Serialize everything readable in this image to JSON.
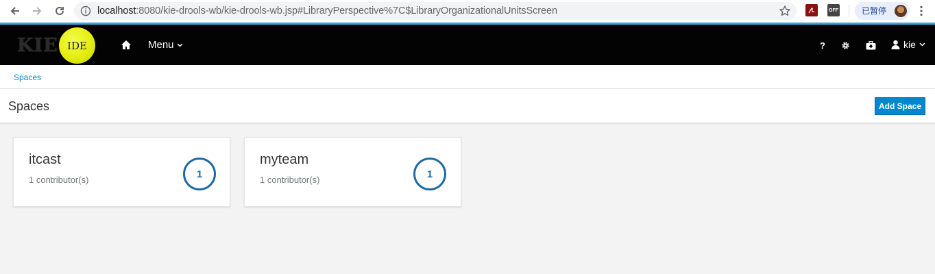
{
  "browser": {
    "url_host": "localhost",
    "url_rest": ":8080/kie-drools-wb/kie-drools-wb.jsp#LibraryPerspective%7C$LibraryOrganizationalUnitsScreen",
    "ext_off_label": "OFF",
    "profile_label": "已暂停",
    "icons": [
      "back-icon",
      "forward-icon",
      "reload-icon",
      "info-icon",
      "bookmark-star-icon",
      "pdf-extension-icon",
      "off-extension-icon",
      "profile-avatar",
      "kebab-menu-icon"
    ]
  },
  "header": {
    "logo_text": "KIE",
    "logo_badge": "IDE",
    "menu_label": "Menu",
    "help_label": "?",
    "user_label": "kie",
    "accent_color": "#39a5dc"
  },
  "breadcrumb": {
    "items": [
      "Spaces"
    ]
  },
  "page": {
    "title": "Spaces",
    "add_button_label": "Add Space"
  },
  "spaces": [
    {
      "name": "itcast",
      "contributors": "1 contributor(s)",
      "count": "1"
    },
    {
      "name": "myteam",
      "contributors": "1 contributor(s)",
      "count": "1"
    }
  ],
  "colors": {
    "primary": "#0088ce",
    "badge": "#1f6aa3",
    "header_bg": "#030303",
    "logo_yellow": "#e4ee0c"
  }
}
